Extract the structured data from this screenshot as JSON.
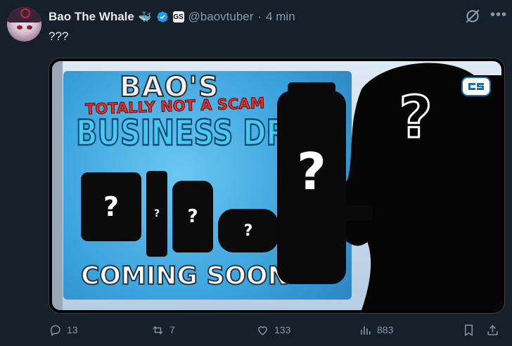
{
  "tweet": {
    "author_name": "Bao The Whale",
    "whale_emoji": "🐳",
    "handle": "@baovtuber",
    "separator": "·",
    "time": "4 min",
    "text": "???"
  },
  "media": {
    "banner_line1": "BAO'S",
    "banner_line2": "TOTALLY NOT A SCAM",
    "banner_line3": "BUSINESS DROP",
    "banner_line4": "COMING SOON",
    "mystery": "?"
  },
  "actions": {
    "replies": "13",
    "reposts": "7",
    "likes": "133",
    "views": "883"
  },
  "colors": {
    "background": "#15202b",
    "verified": "#1d9bf0",
    "muted": "#8b98a5"
  },
  "icons": [
    "grok-icon",
    "more-icon",
    "reply-icon",
    "repost-icon",
    "like-icon",
    "views-icon",
    "bookmark-icon",
    "share-icon",
    "verified-icon"
  ]
}
